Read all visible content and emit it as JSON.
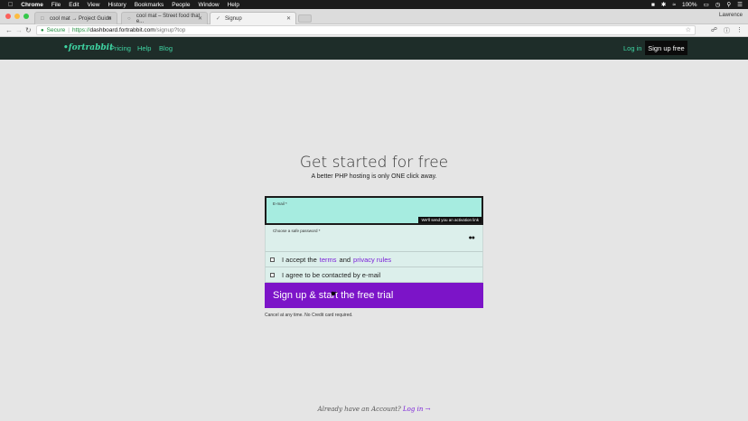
{
  "menubar": {
    "apple": "",
    "items": [
      "Chrome",
      "File",
      "Edit",
      "View",
      "History",
      "Bookmarks",
      "People",
      "Window",
      "Help"
    ],
    "battery": "100%",
    "clock_icon": "clock-icon"
  },
  "tabs": [
    {
      "title": "cool mat → Project Guide"
    },
    {
      "title": "cool mat – Street food that e..."
    },
    {
      "title": "Signup"
    }
  ],
  "browser": {
    "user": "Lawrence",
    "secure_label": "Secure",
    "url_scheme": "https://",
    "url_host": "dashboard.fortrabbit.com",
    "url_path": "/signup?top"
  },
  "site": {
    "logo": "•fortrabbit",
    "nav": [
      "Pricing",
      "Help",
      "Blog"
    ],
    "login": "Log in",
    "signup": "Sign up free",
    "brand_color": "#3fd6a4",
    "header_bg": "#1e2d29"
  },
  "main": {
    "title": "Get started for free",
    "subtitle": "A better PHP hosting is only ONE click away."
  },
  "form": {
    "email_label": "E-mail *",
    "email_hint": "We'll send you an activation link",
    "password_label": "Choose a safe password *",
    "terms_pre": "I accept the",
    "terms_link": "terms",
    "terms_and": "and",
    "privacy_link": "privacy rules",
    "contact_label": "I agree to be contacted by e-mail",
    "submit": "Sign up & start the free trial",
    "note": "Cancel at any time. No Credit card required.",
    "accent_color": "#7c14c8"
  },
  "footer": {
    "text": "Already have an Account?",
    "login_link": "Log in →"
  }
}
